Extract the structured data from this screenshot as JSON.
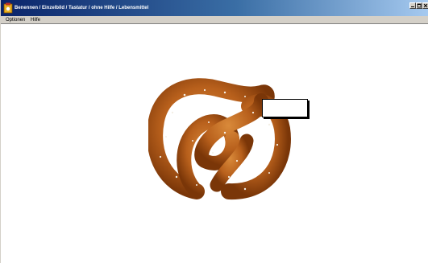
{
  "window": {
    "title": "Benennen / Einzelbild / Tastatur / ohne Hilfe / Lebensmittel",
    "titlebar_color": "#0a246a"
  },
  "menubar": {
    "items": [
      {
        "label": "Optionen"
      },
      {
        "label": "Hilfe"
      }
    ]
  },
  "stimulus": {
    "image_icon": "pretzel-image"
  },
  "answer": {
    "value": ""
  }
}
